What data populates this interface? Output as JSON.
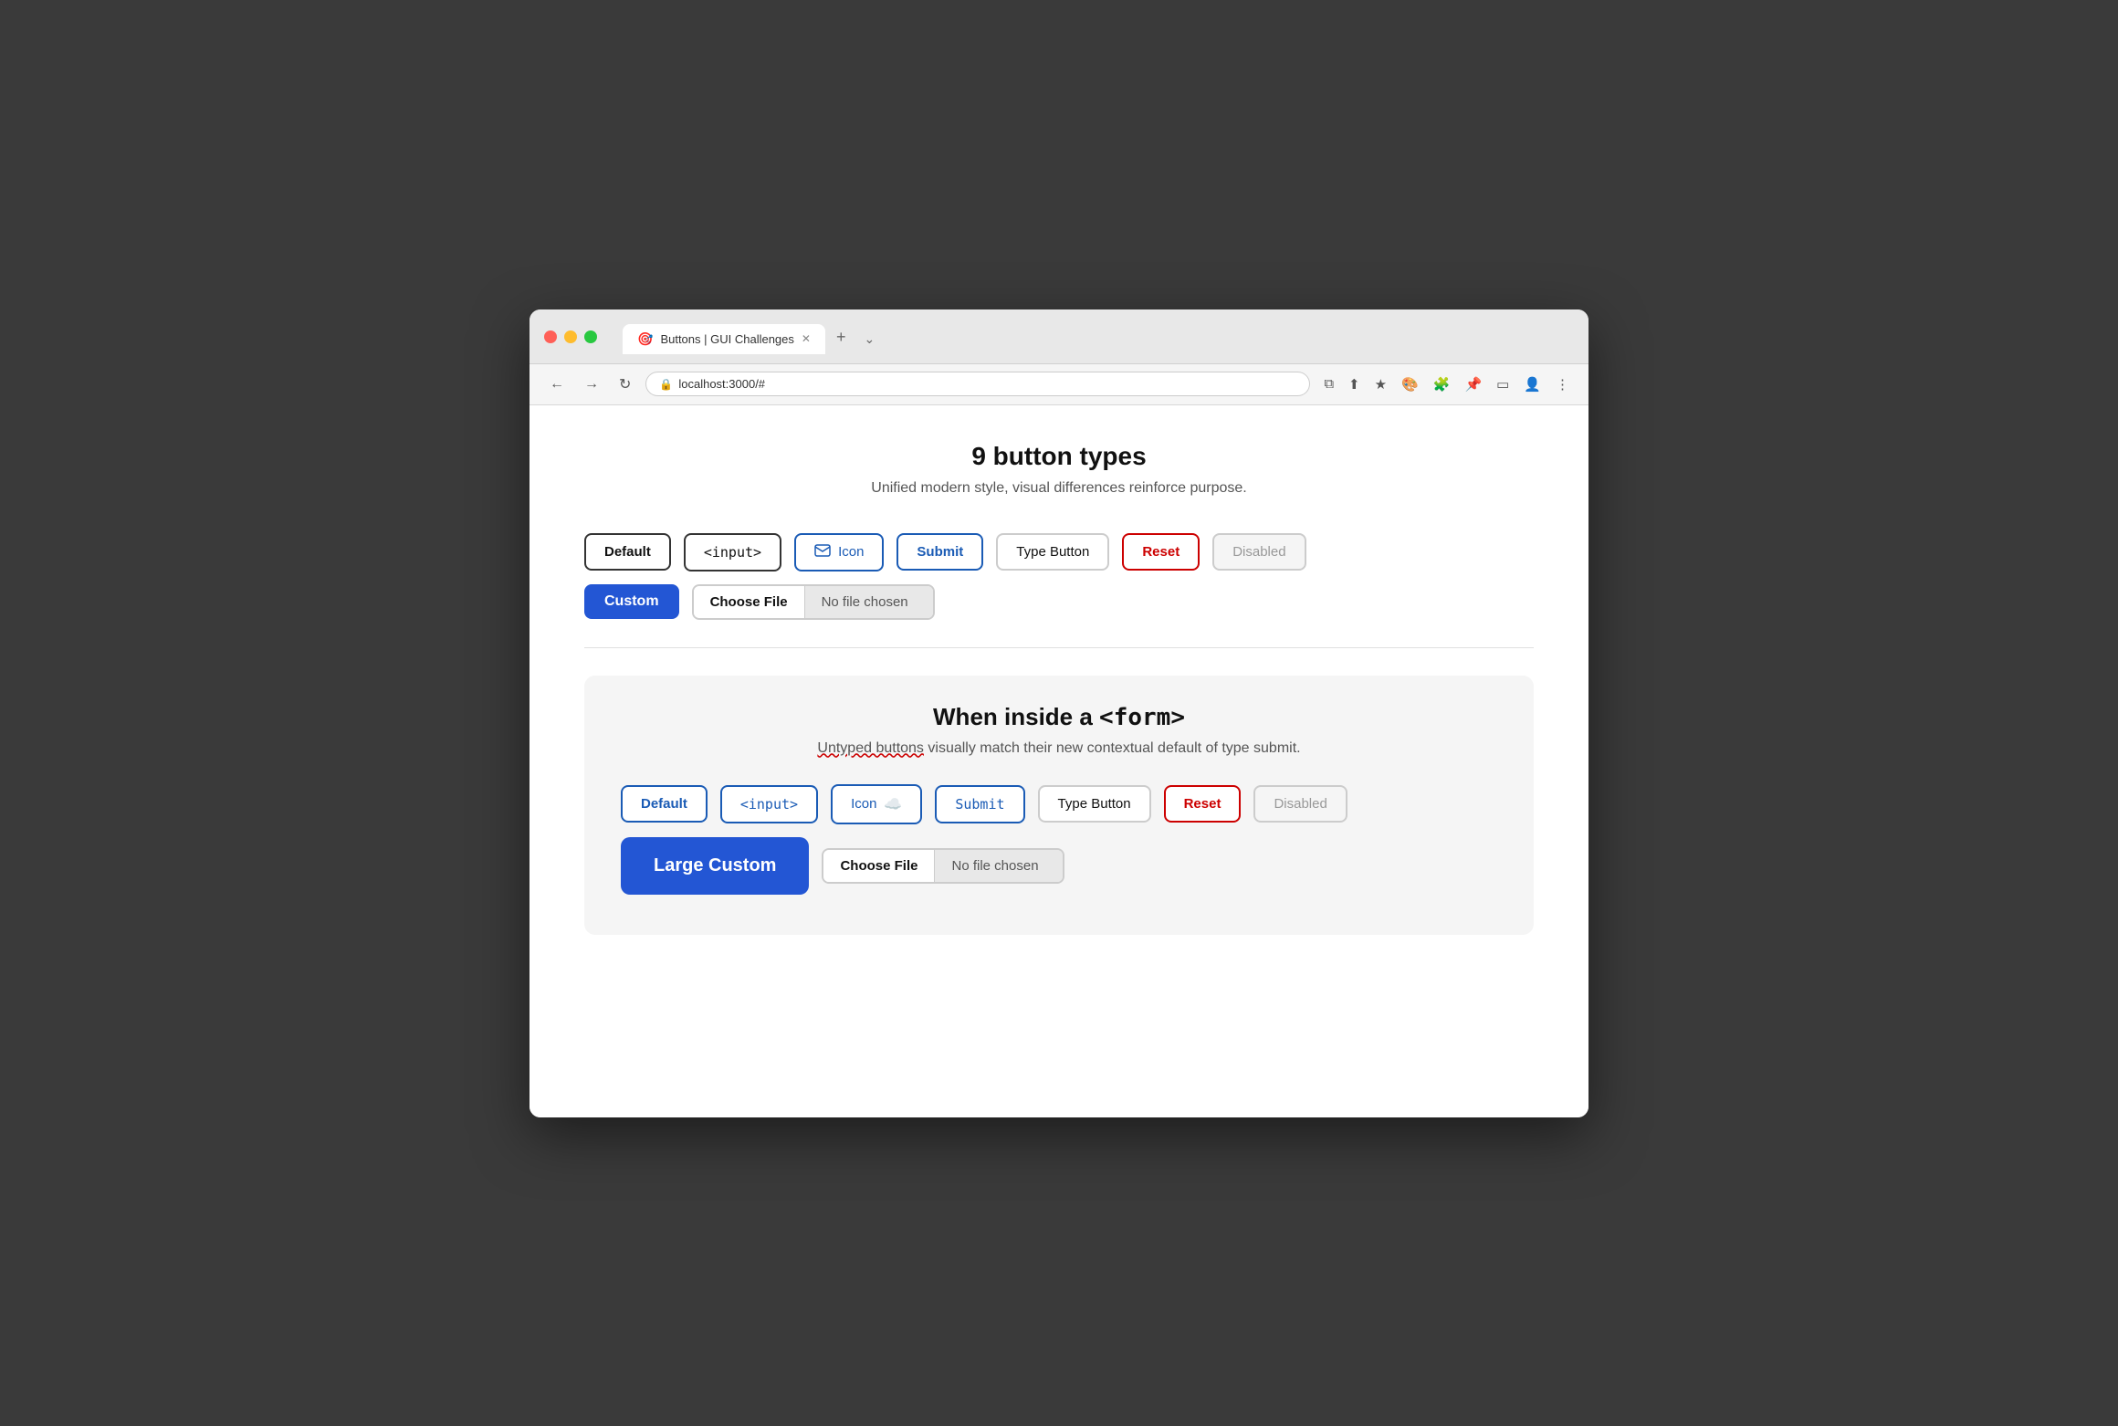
{
  "browser": {
    "tab_title": "Buttons | GUI Challenges",
    "tab_favicon": "🎯",
    "address": "localhost:3000/#",
    "new_tab_label": "+",
    "dropdown_label": "⌄"
  },
  "nav": {
    "back": "←",
    "forward": "→",
    "refresh": "↻"
  },
  "page": {
    "main_title": "9 button types",
    "main_subtitle": "Unified modern style, visual differences reinforce purpose.",
    "row1": {
      "default_label": "Default",
      "input_label": "<input>",
      "icon_label": "Icon",
      "submit_label": "Submit",
      "type_button_label": "Type Button",
      "reset_label": "Reset",
      "disabled_label": "Disabled"
    },
    "row2": {
      "custom_label": "Custom",
      "choose_file_label": "Choose File",
      "no_file_chosen_label": "No file chosen"
    },
    "form_section": {
      "title_start": "When inside a ",
      "title_code": "<form>",
      "subtitle_untyped": "Untyped buttons",
      "subtitle_rest": " visually match their new contextual default of type submit.",
      "row1": {
        "default_label": "Default",
        "input_label": "<input>",
        "icon_label": "Icon",
        "submit_label": "Submit",
        "type_button_label": "Type Button",
        "reset_label": "Reset",
        "disabled_label": "Disabled"
      },
      "row2": {
        "large_custom_label": "Large Custom",
        "choose_file_label": "Choose File",
        "no_file_chosen_label": "No file chosen"
      }
    }
  }
}
